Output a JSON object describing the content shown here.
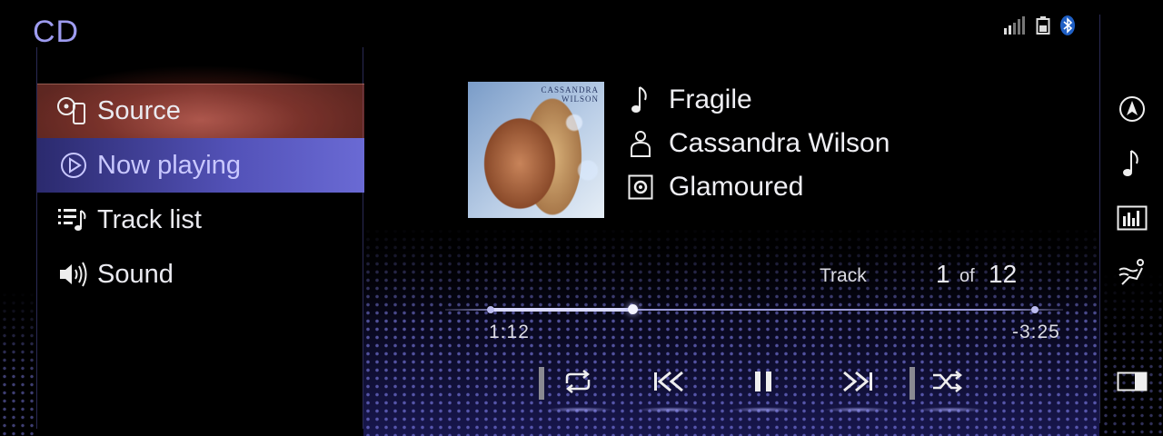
{
  "app": {
    "title": "CD"
  },
  "menu": {
    "items": [
      {
        "label": "Source",
        "icon": "disc-phone-icon",
        "state": "highlighted"
      },
      {
        "label": "Now playing",
        "icon": "play-circle-icon",
        "state": "selected"
      },
      {
        "label": "Track list",
        "icon": "track-list-icon",
        "state": "normal"
      },
      {
        "label": "Sound",
        "icon": "speaker-icon",
        "state": "normal"
      }
    ]
  },
  "status": {
    "icons": [
      "signal-bars-icon",
      "battery-icon",
      "bluetooth-icon"
    ]
  },
  "rail": {
    "buttons": [
      "navigation-icon",
      "music-note-icon",
      "equalizer-icon",
      "climate-icon",
      "split-screen-icon"
    ]
  },
  "album": {
    "art_text_line1": "CASSANDRA",
    "art_text_line2": "WILSON"
  },
  "track": {
    "title": "Fragile",
    "artist": "Cassandra Wilson",
    "album": "Glamoured",
    "label": "Track",
    "number": "1",
    "of": "of",
    "total": "12"
  },
  "progress": {
    "elapsed": "1:12",
    "remaining": "-3:25",
    "fraction": 0.26
  },
  "controls": [
    "repeat-icon",
    "previous-track-icon",
    "pause-icon",
    "next-track-icon",
    "shuffle-icon"
  ],
  "colors": {
    "accent": "#9e9cf0",
    "selected_bg": "#5352b8",
    "source_bg": "#c05a50"
  }
}
